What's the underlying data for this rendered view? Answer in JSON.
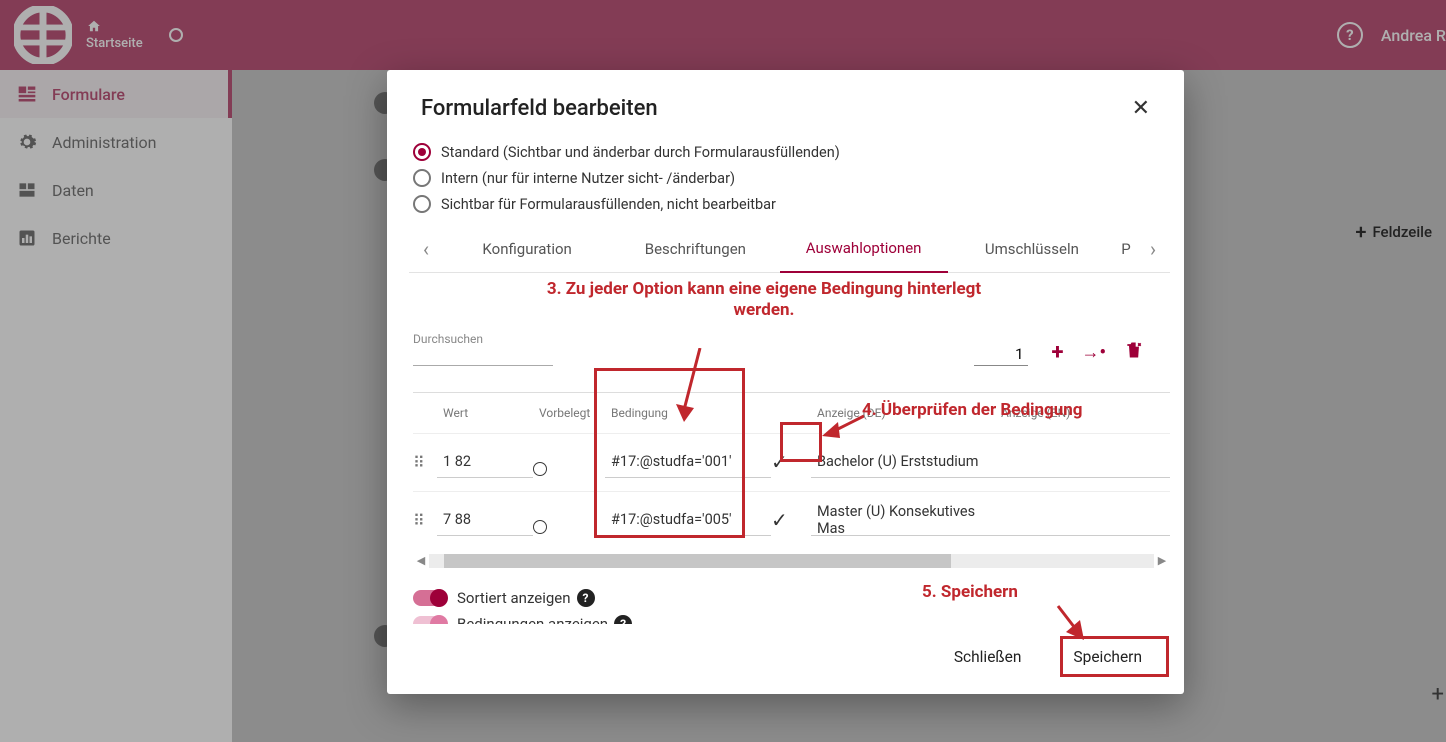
{
  "topbar": {
    "home_label": "Startseite",
    "user_name": "Andrea R"
  },
  "sidebar": {
    "items": [
      {
        "label": "Formulare"
      },
      {
        "label": "Administration"
      },
      {
        "label": "Daten"
      },
      {
        "label": "Berichte"
      }
    ]
  },
  "right_button": {
    "label": "Feldzeile"
  },
  "modal": {
    "title": "Formularfeld bearbeiten",
    "radios": {
      "standard": "Standard (Sichtbar und änderbar durch Formularausfüllenden)",
      "intern": "Intern (nur für interne Nutzer sicht- /änderbar)",
      "visible_ro": "Sichtbar für Formularausfüllenden, nicht bearbeitbar"
    },
    "tabs": {
      "t0": "Konfiguration",
      "t1": "Beschriftungen",
      "t2": "Auswahloptionen",
      "t3": "Umschlüsseln",
      "t4": "P"
    },
    "search_label": "Durchsuchen",
    "page_value": "1",
    "table": {
      "headers": {
        "wert": "Wert",
        "vorbelegt": "Vorbelegt",
        "bedingung": "Bedingung",
        "anzeige_de": "Anzeige (DE)",
        "anzeige_en": "Anzeige (EN)"
      },
      "rows": [
        {
          "wert": "1 82",
          "bedingung": "#17:@studfa='001'",
          "anzeige_de": "Bachelor (U) Erststudium",
          "anzeige_en": ""
        },
        {
          "wert": "7 88",
          "bedingung": "#17:@studfa='005'",
          "anzeige_de": "Master (U) Konsekutives Mas",
          "anzeige_en": ""
        }
      ]
    },
    "toggles": {
      "sorted": "Sortiert anzeigen",
      "conditions": "Bedingungen anzeigen"
    },
    "footer": {
      "close": "Schließen",
      "save": "Speichern"
    }
  },
  "annotations": {
    "a3": "3. Zu jeder Option kann eine eigene Bedingung hinterlegt werden.",
    "a4": "4. Überprüfen der Bedingung",
    "a5": "5. Speichern"
  }
}
